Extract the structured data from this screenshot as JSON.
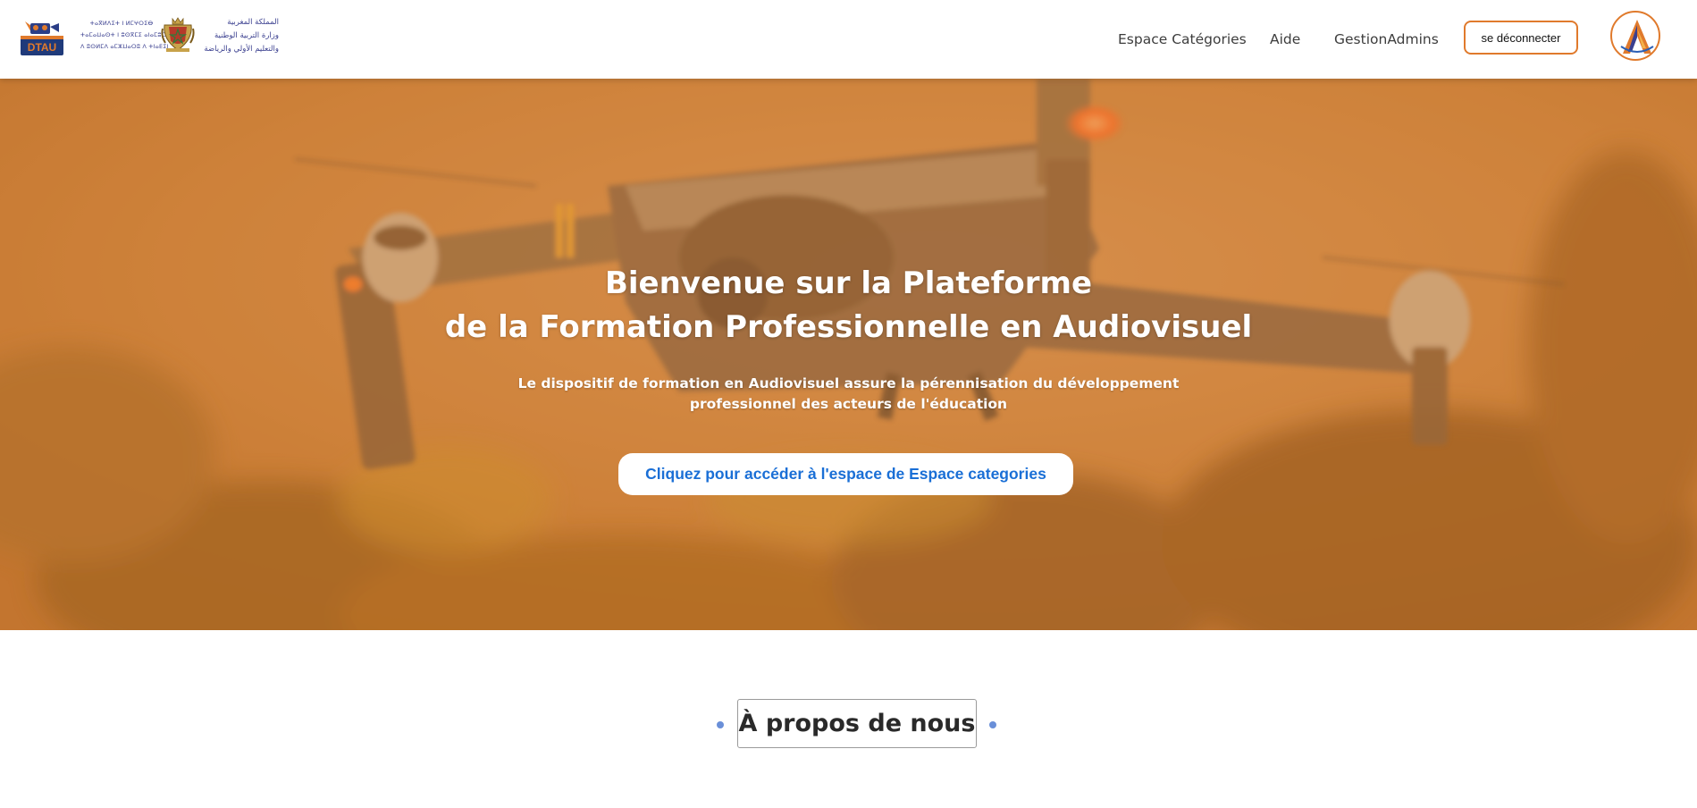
{
  "header": {
    "logo_text": "DTAU",
    "ministry_tifinagh": [
      "ⵜⴰⴳⵍⴷⵉⵜ ⵏ ⵍⵎⵖⵔⵉⴱ",
      "ⵜⴰⵎⴰⵡⴰⵙⵜ ⵏ ⵓⵙⴳⵎⵉ ⴰⵏⴰⵎⵓⵔ",
      "ⴷ ⵓⵙⵍⵎⴷ ⴰⵎⵣⵡⴰⵔⵓ ⴷ ⵜⵏⴰⴹⵉⵏ"
    ],
    "ministry_arabic": [
      "المملكة المغربية",
      "وزارة التربية الوطنية",
      "والتعليم الأولي والرياضة"
    ],
    "nav": [
      {
        "label": "Espace Catégories"
      },
      {
        "label": "Aide"
      },
      {
        "label": "GestionAdmins"
      }
    ],
    "logout_label": "se déconnecter",
    "avatar_icon": "user-logo-icon"
  },
  "hero": {
    "title_line1": "Bienvenue sur la Plateforme",
    "title_line2": "de la Formation Professionnelle en Audiovisuel",
    "subtitle_line1": "Le dispositif de formation en Audiovisuel assure la pérennisation du développement",
    "subtitle_line2": "professionnel des acteurs de l'éducation",
    "cta_label": "Cliquez pour accéder à l'espace de Espace categories",
    "background_image": "drone-photo-orange-tint"
  },
  "about": {
    "heading": "À propos de nous"
  },
  "colors": {
    "accent_orange": "#e07a2c",
    "hero_tint": "#d68030",
    "cta_text": "#1a6fd6",
    "about_dot": "#6a8fd8"
  }
}
